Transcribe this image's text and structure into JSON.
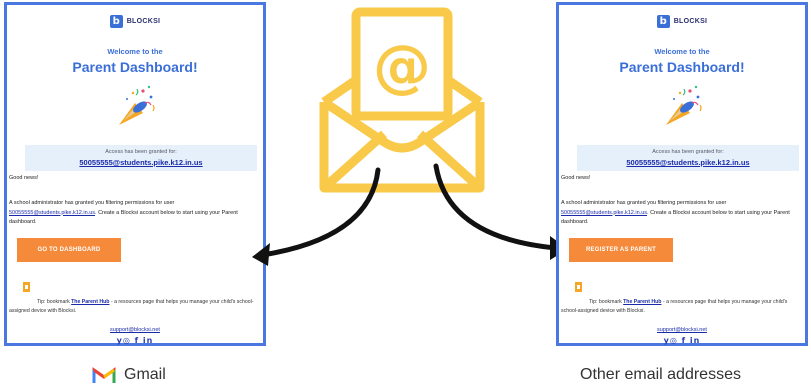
{
  "brand": {
    "logo_letter": "b",
    "logo_name": "BLOCKSI"
  },
  "panels": [
    {
      "id": "gmail",
      "welcome": "Welcome to the",
      "title": "Parent Dashboard!",
      "access_label": "Access has been granted for:",
      "access_email": "50055555@students.pike.k12.in.us",
      "good_news": "Good news!",
      "body_prefix": "A school administrator has granted you filtering permissions for user",
      "body_email": "50055555@students.pike.k12.in.us",
      "body_suffix": ". Create a Blocksi account below to start using your Parent dashboard.",
      "cta_label": "GO TO DASHBOARD",
      "tip_prefix": "Tip: bookmark",
      "tip_link": "The Parent Hub",
      "tip_suffix": "- a resources page that helps you manage your child's school-assigned device with Blocksi.",
      "support_email": "support@blocksi.net",
      "socials": "y◎ f in"
    },
    {
      "id": "other",
      "welcome": "Welcome to the",
      "title": "Parent Dashboard!",
      "access_label": "Access has been granted for:",
      "access_email": "50055555@students.pike.k12.in.us",
      "good_news": "Good news!",
      "body_prefix": "A school administrator has granted you filtering permissions for user",
      "body_email": "50055555@students.pike.k12.in.us",
      "body_suffix": ". Create a Blocksi account below to start using your Parent dashboard.",
      "cta_label": "REGISTER AS PARENT",
      "tip_prefix": "Tip: bookmark",
      "tip_link": "The Parent Hub",
      "tip_suffix": "- a resources page that helps you manage your child's school-assigned device with Blocksi.",
      "support_email": "support@blocksi.net",
      "socials": "y◎ f in"
    }
  ],
  "labels": {
    "gmail": "Gmail",
    "other": "Other email addresses"
  },
  "colors": {
    "panel_border": "#4a78e0",
    "accent_blue": "#3b6fd8",
    "cta_orange": "#f58a3a",
    "envelope_yellow": "#f9c94a"
  }
}
